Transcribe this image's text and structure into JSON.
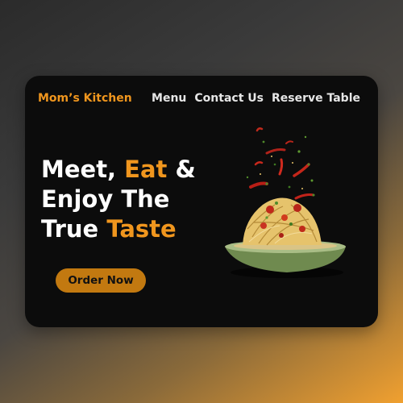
{
  "brand": "Mom’s Kitchen",
  "nav": [
    "Menu",
    "Contact Us",
    "Reserve Table"
  ],
  "hero": {
    "line1_a": "Meet, ",
    "line1_accent": "Eat",
    "line1_b": " &",
    "line2": "Enjoy The",
    "line3_a": "True ",
    "line3_accent": "Taste"
  },
  "cta": "Order Now",
  "image": {
    "subject": "pasta-bowl-with-chili-peppers"
  },
  "colors": {
    "accent": "#f0961e",
    "button": "#c27910",
    "card": "#0c0c0c",
    "text": "#ffffff"
  }
}
